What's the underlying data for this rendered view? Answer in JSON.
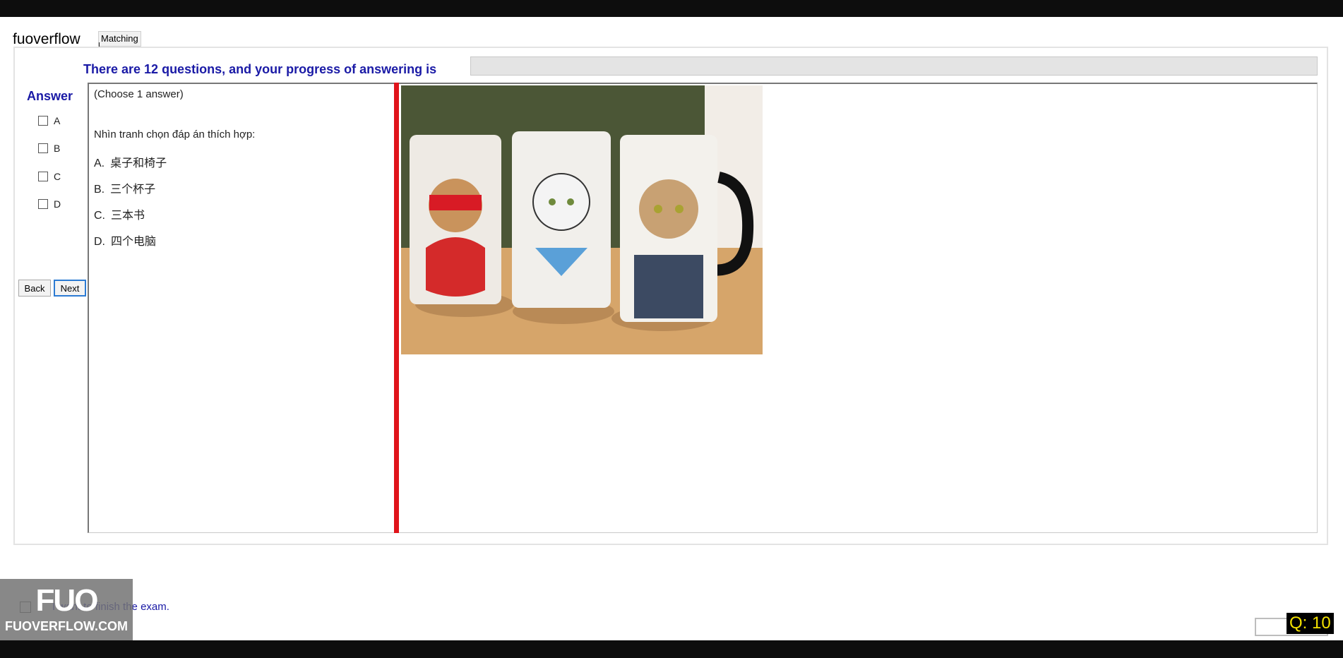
{
  "app": {
    "brand": "fuoverflow",
    "mode_tag": "Matching"
  },
  "progress": {
    "label": "There are 12 questions, and your progress of answering is",
    "fraction": 0
  },
  "answer_panel": {
    "title": "Answer",
    "options": [
      "A",
      "B",
      "C",
      "D"
    ],
    "back_label": "Back",
    "next_label": "Next"
  },
  "question": {
    "instruction": "(Choose 1 answer)",
    "prompt": "Nhìn tranh chọn đáp án thích hợp:",
    "choices": [
      {
        "letter": "A.",
        "text": "桌子和椅子"
      },
      {
        "letter": "B.",
        "text": "三个杯子"
      },
      {
        "letter": "C.",
        "text": "三本书"
      },
      {
        "letter": "D.",
        "text": "四个电脑"
      }
    ]
  },
  "footer": {
    "finish_label": "I want to finish the exam.",
    "question_counter": "Q: 10"
  },
  "watermark": {
    "mark": "FUO",
    "text": "FUOVERFLOW.COM"
  },
  "colors": {
    "accent_blue": "#1a1aa6",
    "splitter_red": "#e0141b",
    "counter_yellow": "#f2e000"
  }
}
